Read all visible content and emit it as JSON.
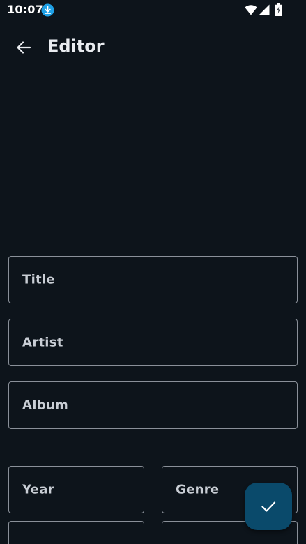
{
  "status_bar": {
    "time": "10:07",
    "icons": [
      "download-icon",
      "wifi-icon",
      "signal-icon",
      "battery-icon"
    ]
  },
  "app_bar": {
    "back_icon": "arrow-left-icon",
    "title": "Editor"
  },
  "form": {
    "title_label": "Title",
    "artist_label": "Artist",
    "album_label": "Album",
    "year_label": "Year",
    "genre_label": "Genre"
  },
  "fab": {
    "icon": "check-icon"
  },
  "colors": {
    "background": "#0d141b",
    "field_border": "#8a9099",
    "fab_background": "#0a4a6b",
    "download_badge": "#1ea0e6"
  }
}
